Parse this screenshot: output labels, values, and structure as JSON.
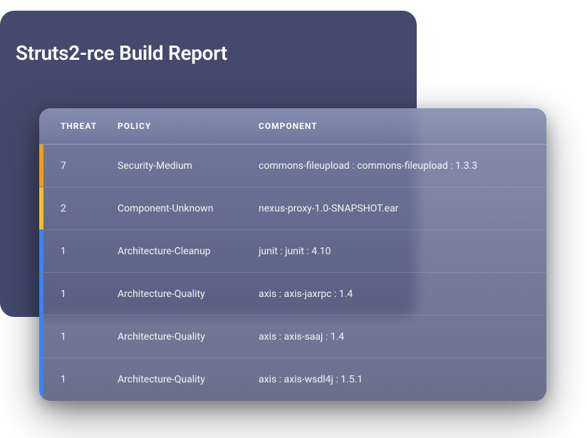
{
  "title": "Struts2-rce Build Report",
  "columns": {
    "threat": "THREAT",
    "policy": "POLICY",
    "component": "COMPONENT"
  },
  "severity_colors": {
    "high": "#f59e0b",
    "medium": "#fbbf24",
    "low": "#3b82f6"
  },
  "rows": [
    {
      "threat": "7",
      "policy": "Security-Medium",
      "component": "commons-fileupload : commons-fileupload : 1.3.3",
      "indicator": "#f59e0b"
    },
    {
      "threat": "2",
      "policy": "Component-Unknown",
      "component": "nexus-proxy-1.0-SNAPSHOT.ear",
      "indicator": "#fbbf24"
    },
    {
      "threat": "1",
      "policy": "Architecture-Cleanup",
      "component": "junit : junit : 4.10",
      "indicator": "#3b82f6"
    },
    {
      "threat": "1",
      "policy": "Architecture-Quality",
      "component": "axis : axis-jaxrpc : 1.4",
      "indicator": "#3b82f6"
    },
    {
      "threat": "1",
      "policy": "Architecture-Quality",
      "component": "axis : axis-saaj : 1.4",
      "indicator": "#3b82f6"
    },
    {
      "threat": "1",
      "policy": "Architecture-Quality",
      "component": "axis : axis-wsdl4j : 1.5.1",
      "indicator": "#3b82f6"
    }
  ]
}
